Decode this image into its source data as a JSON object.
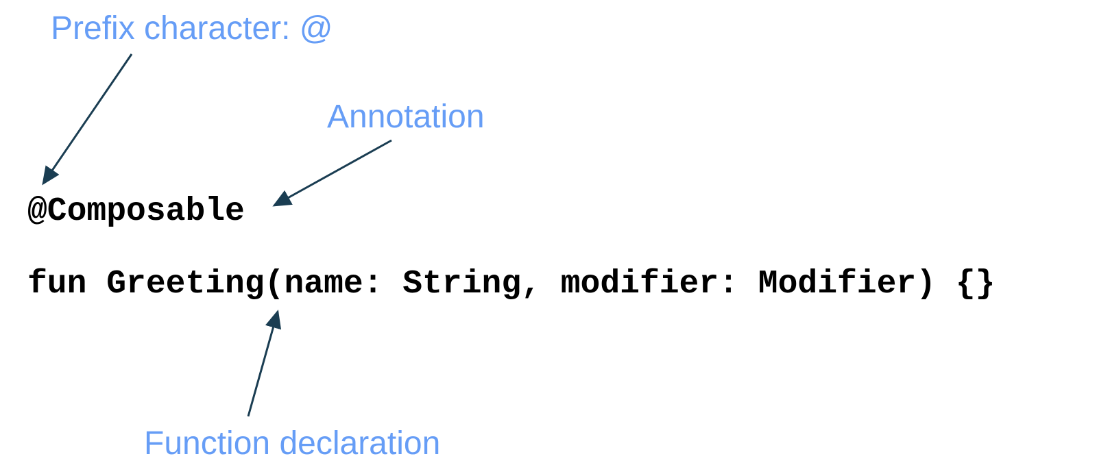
{
  "labels": {
    "prefix": "Prefix character: @",
    "annotation": "Annotation",
    "function_declaration": "Function declaration"
  },
  "code": {
    "line1": "@Composable",
    "line2": "fun Greeting(name: String, modifier: Modifier) {}"
  },
  "colors": {
    "label": "#669df6",
    "arrow": "#1a3d52",
    "code": "#000000"
  }
}
